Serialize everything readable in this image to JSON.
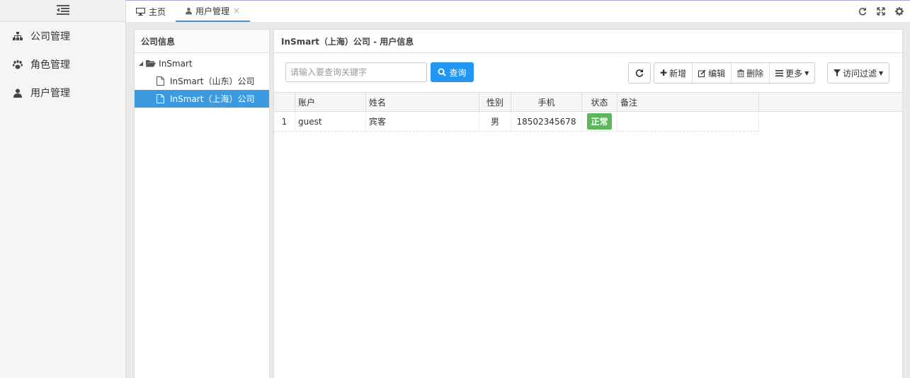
{
  "sidebar": {
    "items": [
      {
        "label": "公司管理",
        "icon": "sitemap-icon"
      },
      {
        "label": "角色管理",
        "icon": "paw-icon"
      },
      {
        "label": "用户管理",
        "icon": "user-icon"
      }
    ]
  },
  "tabs": [
    {
      "label": "主页",
      "icon": "desktop-icon"
    },
    {
      "label": "用户管理",
      "icon": "user-icon",
      "closable": true,
      "close": "×"
    }
  ],
  "company_panel": {
    "title": "公司信息",
    "tree": {
      "root": "InSmart",
      "children": [
        "InSmart（山东）公司",
        "InSmart（上海）公司"
      ],
      "selected_index": 1
    }
  },
  "user_panel": {
    "title": "InSmart（上海）公司 - 用户信息",
    "search": {
      "placeholder": "请输入要查询关键字",
      "value": "",
      "button": "查询"
    },
    "buttons": {
      "add": "新增",
      "edit": "编辑",
      "delete": "删除",
      "more": "更多",
      "filter": "访问过滤"
    },
    "grid": {
      "columns": [
        "账户",
        "姓名",
        "性别",
        "手机",
        "状态",
        "备注"
      ],
      "rows": [
        {
          "index": "1",
          "account": "guest",
          "name": "宾客",
          "sex": "男",
          "phone": "18502345678",
          "status": "正常",
          "remark": ""
        }
      ]
    }
  },
  "colors": {
    "accent": "#2196f3",
    "selected": "#3c9ae0",
    "status_ok": "#5cb85c"
  }
}
